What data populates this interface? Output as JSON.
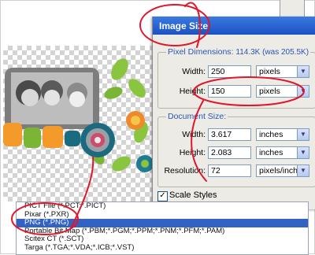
{
  "dialog": {
    "title": "Image Size",
    "pixel_dimensions": {
      "label": "Pixel Dimensions:",
      "size": "114.3K (was 205.5K)"
    },
    "width": {
      "label": "Width:",
      "value": "250",
      "unit": "pixels"
    },
    "height": {
      "label": "Height:",
      "value": "150",
      "unit": "pixels"
    },
    "document_size": {
      "label": "Document Size:",
      "width": {
        "label": "Width:",
        "value": "3.617",
        "unit": "inches"
      },
      "height": {
        "label": "Height:",
        "value": "2.083",
        "unit": "inches"
      },
      "resolution": {
        "label": "Resolution:",
        "value": "72",
        "unit": "pixels/inch"
      }
    },
    "scale_styles": {
      "label": "Scale Styles",
      "checked": true
    }
  },
  "format_list": {
    "items": [
      {
        "label": "PICT File (*.PCT;*.PICT)",
        "selected": false
      },
      {
        "label": "Pixar (*.PXR)",
        "selected": false
      },
      {
        "label": "PNG (*.PNG)",
        "selected": true
      },
      {
        "label": "Portable Bit Map (*.PBM;*.PGM;*.PPM;*.PNM;*.PFM;*.PAM)",
        "selected": false
      },
      {
        "label": "Scitex CT (*.SCT)",
        "selected": false
      },
      {
        "label": "Targa (*.TGA;*.VDA;*.ICB;*.VST)",
        "selected": false
      }
    ]
  },
  "colors": {
    "title_bar": "#1a52c4",
    "selected_row": "#3162c4",
    "annotation": "#e0162b",
    "group_title": "#2a56b0"
  },
  "icons": [
    "chevron-down-icon",
    "checkmark-icon",
    "chain-link-icon"
  ]
}
